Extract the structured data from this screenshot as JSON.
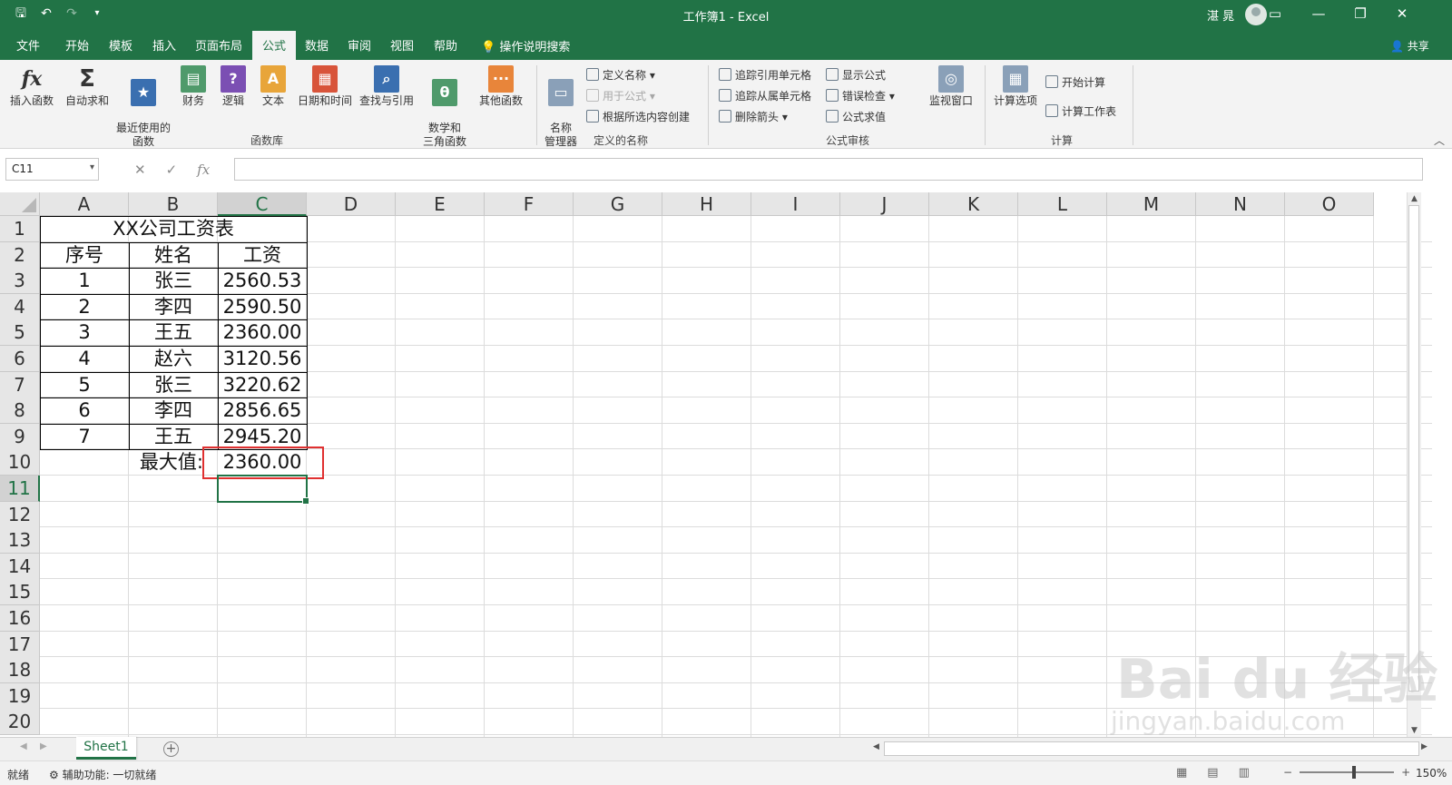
{
  "titlebar": {
    "title": "工作簿1 - Excel",
    "user": "湛 晁",
    "minimize": "—",
    "restore": "❐",
    "close": "✕"
  },
  "tabs": [
    "文件",
    "开始",
    "模板",
    "插入",
    "页面布局",
    "公式",
    "数据",
    "审阅",
    "视图",
    "帮助"
  ],
  "active_tab": "公式",
  "search_tell": "操作说明搜索",
  "share": "共享",
  "ribbon": {
    "function_library": {
      "label": "函数库",
      "buttons": [
        "插入函数",
        "自动求和",
        "最近使用的\n函数",
        "财务",
        "逻辑",
        "文本",
        "日期和时间",
        "查找与引用",
        "数学和\n三角函数",
        "其他函数"
      ]
    },
    "defined_names": {
      "label": "定义的名称",
      "manager": "名称\n管理器",
      "define": "定义名称",
      "use_in_formula": "用于公式",
      "create_from_selection": "根据所选内容创建"
    },
    "formula_auditing": {
      "label": "公式审核",
      "trace_precedents": "追踪引用单元格",
      "trace_dependents": "追踪从属单元格",
      "remove_arrows": "删除箭头",
      "show_formulas": "显示公式",
      "error_checking": "错误检查",
      "evaluate_formula": "公式求值",
      "watch_window": "监视窗口"
    },
    "calculation": {
      "label": "计算",
      "options": "计算选项",
      "calc_now": "开始计算",
      "calc_sheet": "计算工作表"
    }
  },
  "formula_bar": {
    "name_box": "C11",
    "cancel": "✕",
    "enter": "✓",
    "fx": "fx",
    "value": ""
  },
  "sheet": {
    "columns": [
      "A",
      "B",
      "C",
      "D",
      "E",
      "F",
      "G",
      "H",
      "I",
      "J",
      "K",
      "L",
      "M",
      "N",
      "O"
    ],
    "rows": [
      "1",
      "2",
      "3",
      "4",
      "5",
      "6",
      "7",
      "8",
      "9",
      "10",
      "11",
      "12",
      "13",
      "14",
      "15",
      "16",
      "17",
      "18",
      "19",
      "20"
    ],
    "title": "XX公司工资表",
    "headers": [
      "序号",
      "姓名",
      "工资"
    ],
    "data": [
      [
        "1",
        "张三",
        "2560.53"
      ],
      [
        "2",
        "李四",
        "2590.50"
      ],
      [
        "3",
        "王五",
        "2360.00"
      ],
      [
        "4",
        "赵六",
        "3120.56"
      ],
      [
        "5",
        "张三",
        "3220.62"
      ],
      [
        "6",
        "李四",
        "2856.65"
      ],
      [
        "7",
        "王五",
        "2945.20"
      ]
    ],
    "max_label": "最大值:",
    "max_value": "2360.00",
    "selected_cell": "C11"
  },
  "sheet_tabs": [
    "Sheet1"
  ],
  "status": {
    "ready": "就绪",
    "accessibility": "辅助功能: 一切就绪",
    "zoom": "150%"
  },
  "watermark": {
    "brand": "Bai du 经验",
    "url": "jingyan.baidu.com"
  }
}
